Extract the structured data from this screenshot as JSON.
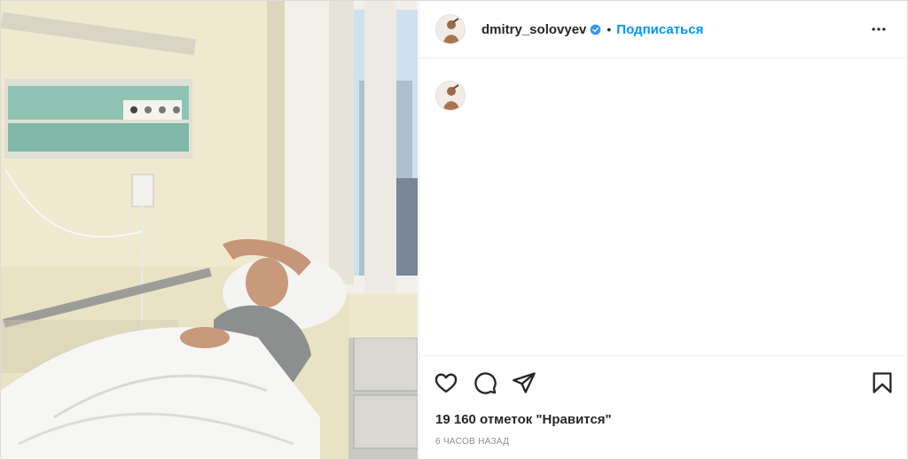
{
  "post": {
    "username": "dmitry_solovyev",
    "follow_label": "Подписаться",
    "separator": "•",
    "likes_text": "19 160 отметок \"Нравится\"",
    "time_text": "6 ЧАСОВ НАЗАД"
  },
  "icons": {
    "verified": "verified-badge-icon",
    "more": "more-options-icon",
    "like": "heart-icon",
    "comment": "comment-icon",
    "share": "paper-plane-icon",
    "save": "bookmark-icon"
  },
  "colors": {
    "accent": "#0095f6",
    "text": "#262626",
    "muted": "#8e8e8e",
    "border": "#efefef"
  }
}
